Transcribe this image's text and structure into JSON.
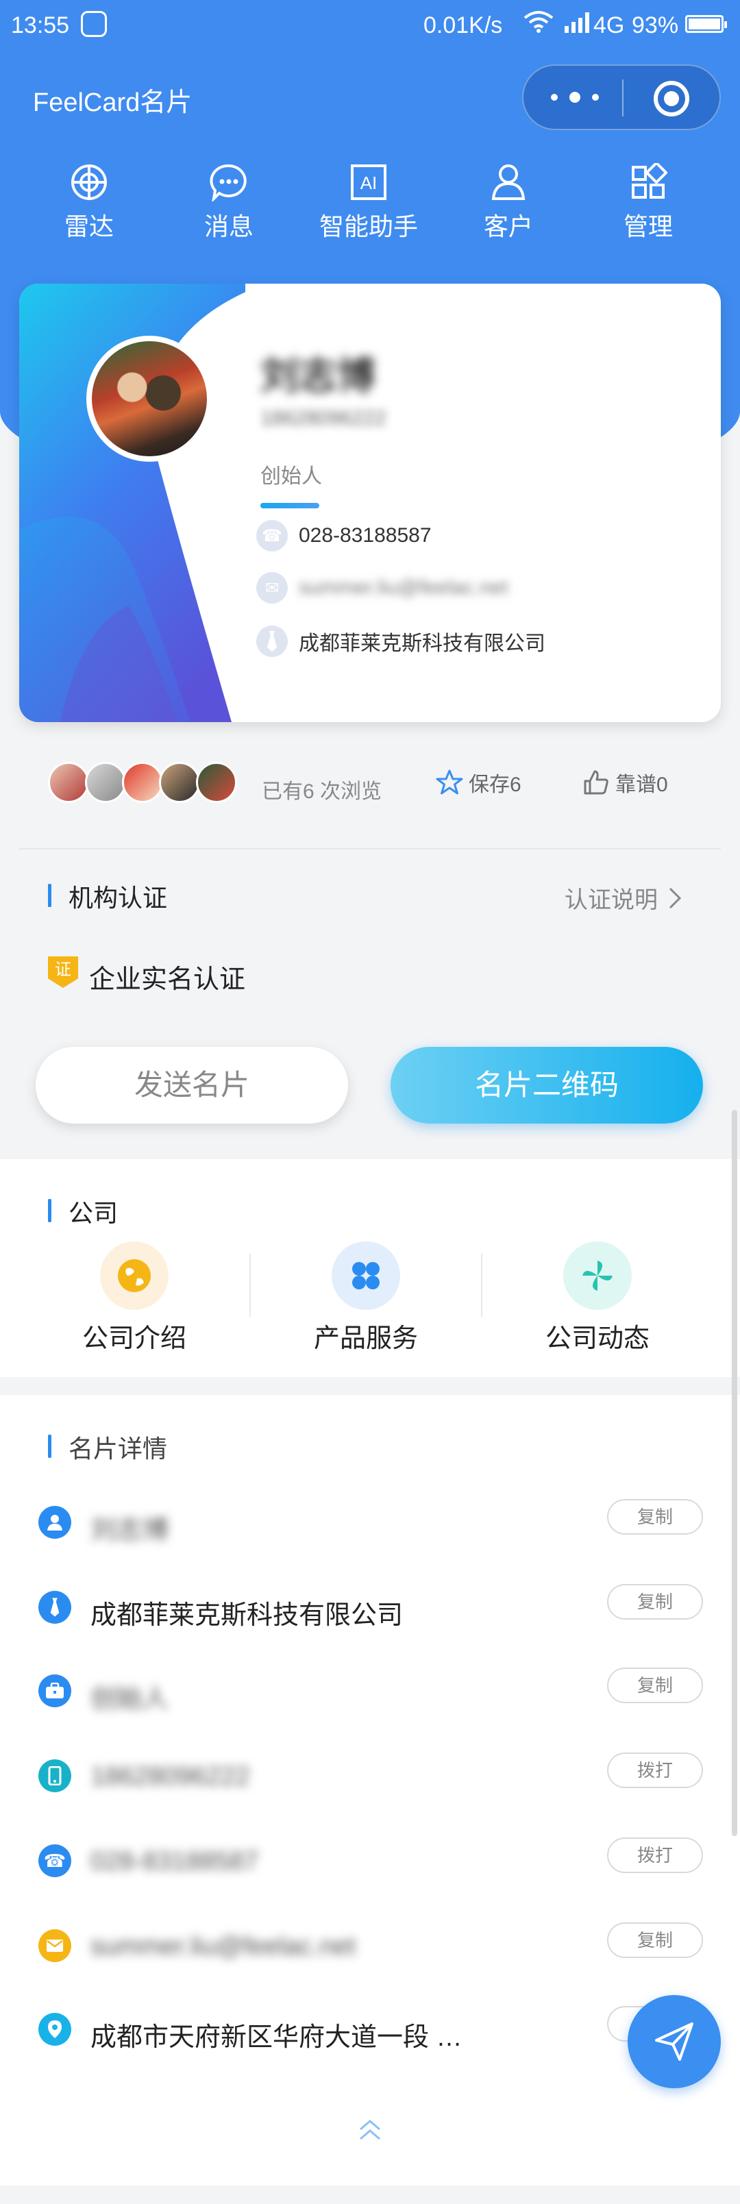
{
  "status_bar": {
    "time": "13:55",
    "speed": "0.01K/s",
    "network": "4G",
    "battery": "93%"
  },
  "app": {
    "title": "FeelCard名片"
  },
  "nav": [
    {
      "label": "雷达",
      "icon": "radar-icon"
    },
    {
      "label": "消息",
      "icon": "chat-bubble-icon"
    },
    {
      "label": "智能助手",
      "icon": "ai-icon"
    },
    {
      "label": "客户",
      "icon": "person-icon"
    },
    {
      "label": "管理",
      "icon": "grid-icon"
    }
  ],
  "card": {
    "name": "刘志博",
    "phone": "18628096222",
    "role": "创始人",
    "landline": "028-83188587",
    "email": "summer.liu@feelac.net",
    "company": "成都菲莱克斯科技有限公司"
  },
  "stats": {
    "views_text": "已有6 次浏览",
    "save_text": "保存6",
    "like_text": "靠谱0"
  },
  "certification": {
    "title": "机构认证",
    "link": "认证说明",
    "badge": "证",
    "item": "企业实名认证"
  },
  "actions": {
    "send": "发送名片",
    "qr": "名片二维码"
  },
  "company_section": {
    "title": "公司",
    "items": [
      {
        "label": "公司介绍",
        "icon": "globe-icon",
        "color": "#f5b514"
      },
      {
        "label": "产品服务",
        "icon": "clover-icon",
        "color": "#2a8cf0"
      },
      {
        "label": "公司动态",
        "icon": "pinwheel-icon",
        "color": "#28c3b0"
      }
    ]
  },
  "details": {
    "title": "名片详情",
    "rows": [
      {
        "value": "刘志博",
        "action": "复制",
        "icon": "person-icon",
        "color": "#2a8cf0"
      },
      {
        "value": "成都菲莱克斯科技有限公司",
        "action": "复制",
        "icon": "tie-icon",
        "color": "#2a8cf0"
      },
      {
        "value": "创始人",
        "action": "复制",
        "icon": "briefcase-icon",
        "color": "#2a8cf0"
      },
      {
        "value": "18628096222",
        "action": "拨打",
        "icon": "mobile-icon",
        "color": "#18b2c8"
      },
      {
        "value": "028-83188587",
        "action": "拨打",
        "icon": "telephone-icon",
        "color": "#2a8cf0"
      },
      {
        "value": "summer.liu@feelac.net",
        "action": "复制",
        "icon": "mail-icon",
        "color": "#f5b514"
      },
      {
        "value": "成都市天府新区华府大道一段 …",
        "action": "复制",
        "icon": "location-icon",
        "color": "#18b2e8"
      }
    ]
  }
}
